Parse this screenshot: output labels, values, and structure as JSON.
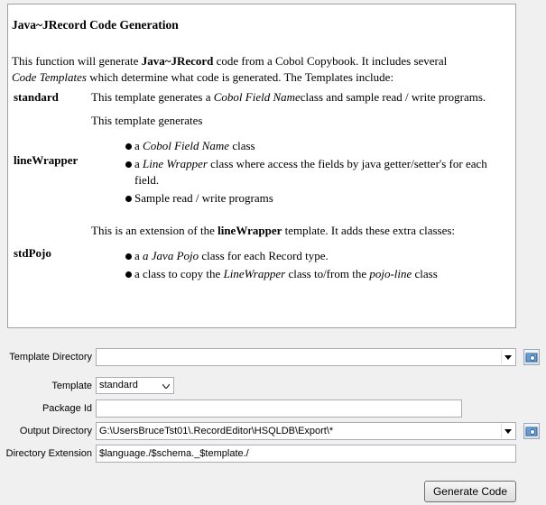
{
  "help": {
    "title": "Java~JRecord Code Generation",
    "intro_1": "This function will generate ",
    "intro_bold": "Java~JRecord",
    "intro_2": " code from a Cobol Copybook. It includes several",
    "intro_italic": "Code Templates",
    "intro_3": " which determine what code is generated. The Templates include:",
    "templates": {
      "standard": {
        "name": "standard",
        "desc_1": "This template generates a ",
        "desc_italic": "Cobol Field Name",
        "desc_2": "class and sample read / write programs."
      },
      "lineWrapper": {
        "name": "lineWrapper",
        "intro": "This template generates",
        "b1_pre": "a ",
        "b1_italic": "Cobol Field Name",
        "b1_post": " class",
        "b2_pre": "a ",
        "b2_italic": "Line Wrapper",
        "b2_post": " class where access the fields by java getter/setter's for each field.",
        "b3": "Sample read / write programs"
      },
      "stdPojo": {
        "name": "stdPojo",
        "intro_1": "This is an extension of the ",
        "intro_bold": "lineWrapper",
        "intro_2": " template. It adds these extra classes:",
        "b1_pre": "a ",
        "b1_italic": "a Java Pojo",
        "b1_post": " class for each Record type.",
        "b2_pre": "a class to copy the ",
        "b2_italic": "LineWrapper",
        "b2_mid": " class to/from the ",
        "b2_italic2": "pojo-line",
        "b2_post": " class"
      }
    }
  },
  "form": {
    "template_directory": {
      "label": "Template Directory",
      "value": ""
    },
    "template": {
      "label": "Template",
      "value": "standard"
    },
    "package_id": {
      "label": "Package Id",
      "value": ""
    },
    "output_directory": {
      "label": "Output Directory",
      "value": "G:\\UsersBruceTst01\\.RecordEditor\\HSQLDB\\Export\\*"
    },
    "directory_extension": {
      "label": "Directory Extension",
      "value": "$language./$schema._$template./"
    }
  },
  "buttons": {
    "generate_code": "Generate Code"
  },
  "icons": {
    "directory_chooser": "folder-search-icon",
    "dropdown": "chevron-down-icon"
  }
}
